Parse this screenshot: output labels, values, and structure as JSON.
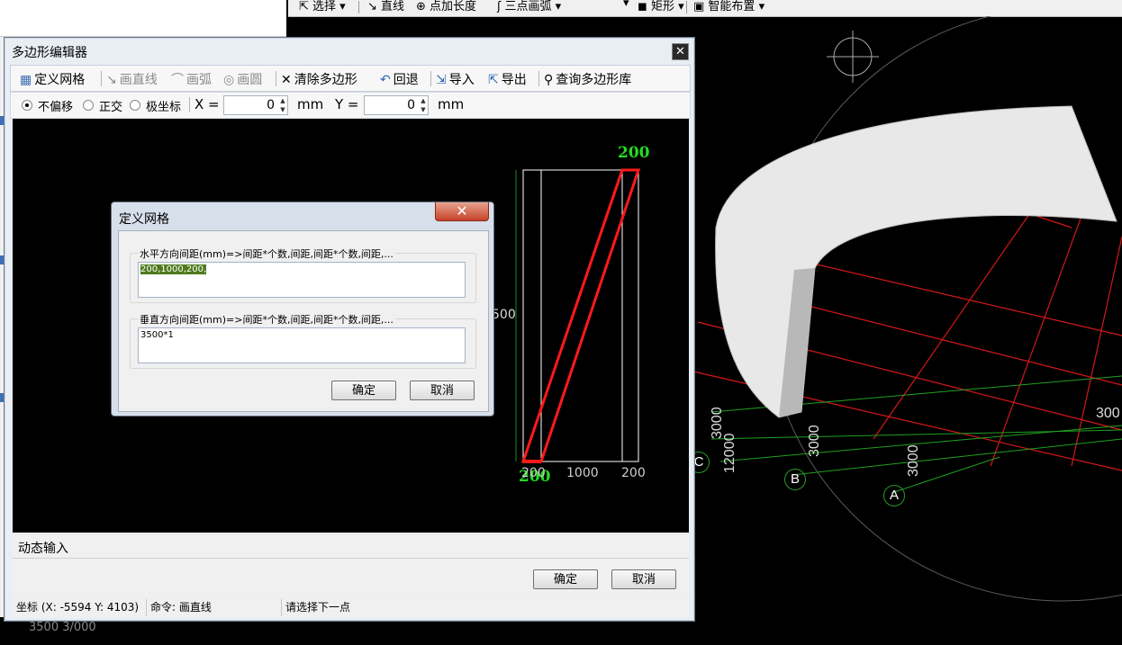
{
  "background_app": {
    "toolbar": {
      "select_label": "选择",
      "line_label": "直线",
      "point_length_label": "点加长度",
      "three_point_arc_label": "三点画弧",
      "rectangle_label": "矩形",
      "smart_layout_label": "智能布置"
    },
    "left_bottom_text": "3500 3/000",
    "viewport": {
      "labels": [
        "3000",
        "12000",
        "3000",
        "3000",
        "300"
      ],
      "axis_bubbles": [
        "C",
        "B",
        "A"
      ]
    }
  },
  "polygon_editor": {
    "title": "多边形编辑器",
    "close_glyph": "✕",
    "toolbar": {
      "define_grid": "定义网格",
      "draw_line": "画直线",
      "draw_arc": "画弧",
      "draw_circle": "画圆",
      "clear_polygon": "清除多边形",
      "undo": "回退",
      "import": "导入",
      "export": "导出",
      "query_library": "查询多边形库"
    },
    "options": {
      "no_offset": "不偏移",
      "orthogonal": "正交",
      "polar": "极坐标",
      "selected": "no_offset"
    },
    "coords": {
      "x_label": "X =",
      "x_value": "0",
      "y_label": "Y =",
      "y_value": "0",
      "unit": "mm"
    },
    "canvas": {
      "dim_top": "200",
      "dim_bottom": "200",
      "dim_height_partial": "500",
      "grid_labels": [
        "200",
        "1000",
        "200"
      ]
    },
    "dynamic_input": "动态输入",
    "ok_label": "确定",
    "cancel_label": "取消",
    "status": {
      "coords": "坐标 (X: -5594 Y: 4103)",
      "command": "命令: 画直线",
      "prompt": "请选择下一点"
    }
  },
  "grid_dialog": {
    "title": "定义网格",
    "close_glyph": "✕",
    "horizontal_label": "水平方向间距(mm)=>间距*个数,间距,间距*个数,间距,...",
    "horizontal_value": "200,1000,200,",
    "vertical_label": "垂直方向间距(mm)=>间距*个数,间距,间距*个数,间距,...",
    "vertical_value": "3500*1",
    "ok_label": "确定",
    "cancel_label": "取消"
  },
  "colors": {
    "polygon_red": "#ff1a1a",
    "dim_green": "#22dd22",
    "grid_red": "#d41818",
    "axis_green": "#20a020",
    "highlight": "#4e7a1c"
  }
}
